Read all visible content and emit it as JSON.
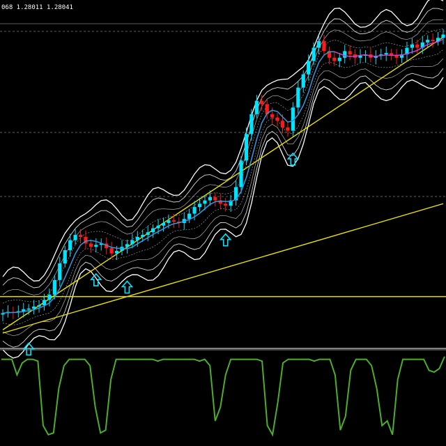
{
  "chart_data": {
    "type": "candlestick",
    "header_text": "068 1.28011 1.28041",
    "colors": {
      "background": "#000000",
      "bull_candle": "#00e5ff",
      "bear_candle": "#ff1a1a",
      "moving_average": "#2f9be0",
      "moving_average_recent": "#d040d0",
      "envelope_outer": "#ffffff",
      "envelope_mid": "#d8d8d8",
      "envelope_inner": "#b0b0b0",
      "trendline": "#e8e000",
      "horizontal_line": "#e8e000",
      "grid": "#bbbbbb",
      "signal_arrow": "#00e5ff",
      "oscillator": "#4caf28"
    },
    "grid_dashed_horizontal": true,
    "price_panel": {
      "closes": [
        0.3,
        0.32,
        0.31,
        0.33,
        0.36,
        0.37,
        0.4,
        0.42,
        0.5,
        0.58,
        0.8,
        1.05,
        1.25,
        1.4,
        1.48,
        1.45,
        1.35,
        1.3,
        1.33,
        1.35,
        1.28,
        1.2,
        1.24,
        1.3,
        1.34,
        1.4,
        1.45,
        1.48,
        1.52,
        1.58,
        1.62,
        1.66,
        1.7,
        1.68,
        1.66,
        1.72,
        1.8,
        1.9,
        1.95,
        2.0,
        2.05,
        2.0,
        1.95,
        1.92,
        2.0,
        2.2,
        2.6,
        3.0,
        3.3,
        3.5,
        3.45,
        3.3,
        3.25,
        3.2,
        3.1,
        3.05,
        3.4,
        3.7,
        3.9,
        4.1,
        4.3,
        4.4,
        4.25,
        4.15,
        4.1,
        4.15,
        4.25,
        4.2,
        4.15,
        4.18,
        4.2,
        4.15,
        4.18,
        4.2,
        4.22,
        4.18,
        4.15,
        4.2,
        4.3,
        4.35,
        4.3,
        4.38,
        4.42,
        4.4,
        4.45,
        4.5
      ],
      "signal_arrows_at_index": [
        5,
        18,
        24,
        43,
        56
      ],
      "trendlines": [
        {
          "name": "steep-trendline",
          "from": [
            0,
            0.05
          ],
          "to": [
            85,
            4.46
          ]
        },
        {
          "name": "shallow-trendline",
          "from": [
            0,
            0.0
          ],
          "to": [
            85,
            1.95
          ]
        }
      ],
      "horizontal_line_value": 0.55
    },
    "oscillator_panel": {
      "ylim": [
        0,
        100
      ],
      "values": [
        92,
        92,
        92,
        75,
        88,
        92,
        92,
        90,
        20,
        10,
        12,
        60,
        85,
        92,
        92,
        92,
        92,
        85,
        40,
        12,
        15,
        70,
        92,
        92,
        92,
        92,
        92,
        92,
        92,
        92,
        90,
        92,
        92,
        92,
        92,
        92,
        92,
        92,
        90,
        92,
        85,
        25,
        40,
        75,
        92,
        92,
        92,
        92,
        92,
        92,
        90,
        20,
        10,
        45,
        88,
        92,
        92,
        92,
        92,
        92,
        90,
        92,
        92,
        92,
        75,
        15,
        30,
        80,
        92,
        92,
        92,
        85,
        60,
        20,
        25,
        10,
        70,
        92,
        92,
        92,
        92,
        92,
        80,
        78,
        82,
        95
      ]
    }
  }
}
